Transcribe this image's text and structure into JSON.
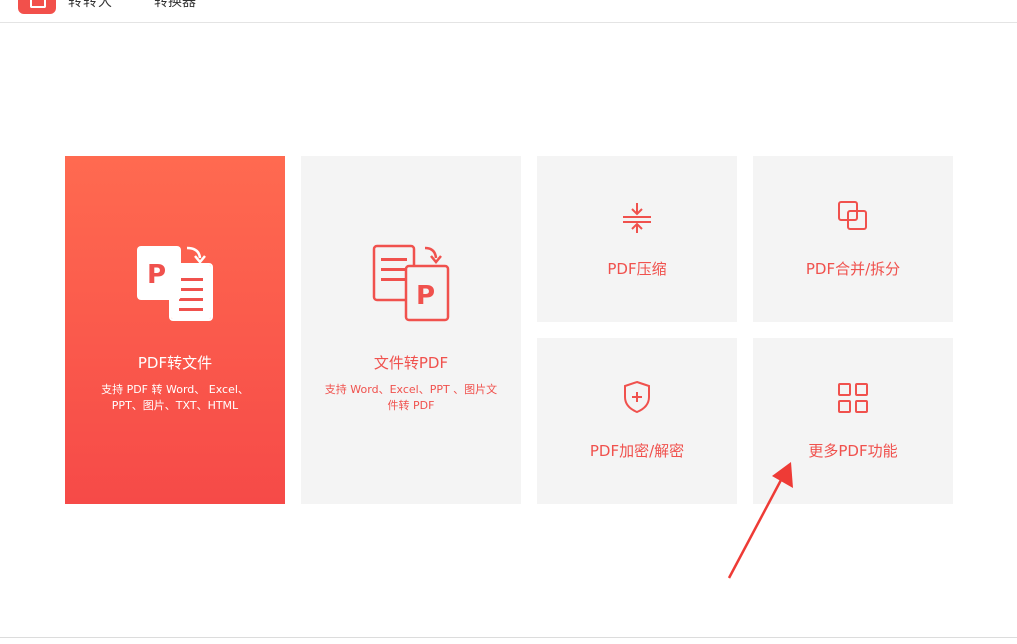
{
  "header": {
    "app_name": "转转大",
    "app_subtitle": "转换器"
  },
  "cards": {
    "pdf_to_file": {
      "title": "PDF转文件",
      "desc": "支持 PDF 转 Word、 Excel、PPT、图片、TXT、HTML"
    },
    "file_to_pdf": {
      "title": "文件转PDF",
      "desc": "支持 Word、Excel、PPT 、图片文件转 PDF"
    },
    "compress": {
      "title": "PDF压缩"
    },
    "merge_split": {
      "title": "PDF合并/拆分"
    },
    "encrypt": {
      "title": "PDF加密/解密"
    },
    "more": {
      "title": "更多PDF功能"
    }
  },
  "colors": {
    "accent": "#f0514d",
    "card_bg": "#f4f4f4",
    "primary_top": "#ff6a50",
    "primary_bottom": "#f64a48",
    "arrow": "#ee3b36"
  },
  "icons": [
    "pdf-to-file-icon",
    "file-to-pdf-icon",
    "compress-icon",
    "merge-split-icon",
    "encrypt-shield-icon",
    "more-grid-icon"
  ]
}
